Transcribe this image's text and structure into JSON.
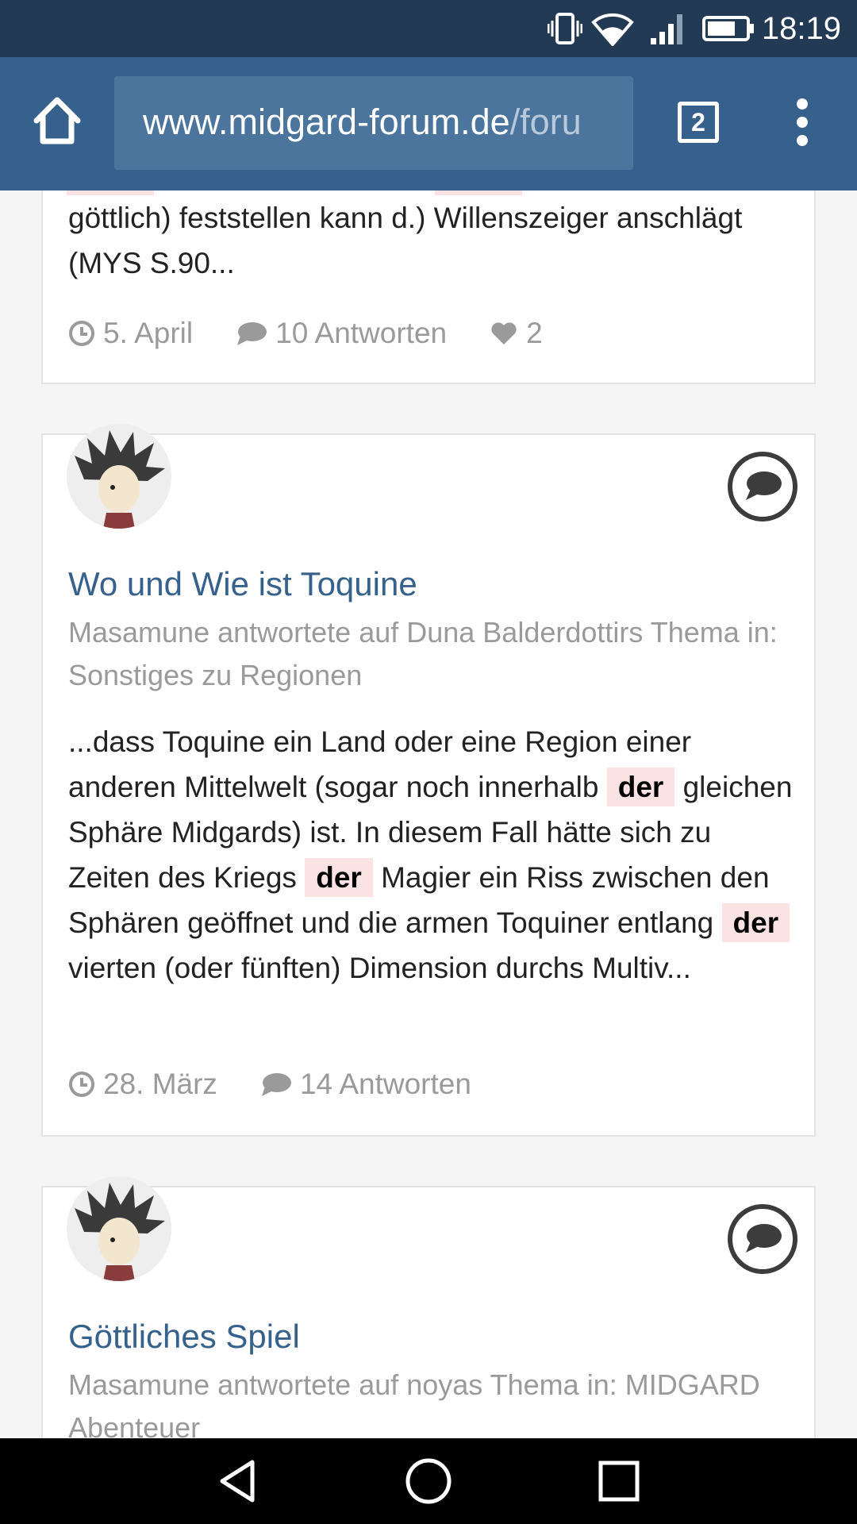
{
  "status_bar": {
    "time": "18:19",
    "icons": [
      "vibrate-icon",
      "wifi-icon",
      "signal-icon",
      "battery-icon"
    ]
  },
  "browser": {
    "url_domain": "www.midgard-forum.de",
    "url_path": "/foru",
    "tab_count": "2",
    "icons": [
      "home-icon",
      "tabs-icon",
      "overflow-menu-icon"
    ]
  },
  "results": [
    {
      "excerpt_lines": [
        "göttlich) feststellen kann d.) Willenszeiger anschlägt",
        "(MYS S.90..."
      ],
      "date": "5. April",
      "replies": "10 Antworten",
      "likes": "2"
    },
    {
      "title": "Wo und Wie ist Toquine",
      "meta": "Masamune antwortete auf Duna Balderdottirs Thema in: Sonstiges zu Regionen",
      "excerpt": {
        "p1": "...dass Toquine ein Land oder eine Region einer anderen Mittelwelt (sogar noch innerhalb",
        "hl1": "der",
        "p2": " gleichen Sphäre Midgards) ist. In diesem Fall hätte sich zu Zeiten des Kriegs",
        "hl2": "der",
        "p3": " Magier ein Riss zwischen den Sphären geöffnet und die armen Toquiner entlang",
        "hl3": "der",
        "p4": " vierten (oder fünften) Dimension durchs Multiv..."
      },
      "date": "28. März",
      "replies": "14 Antworten"
    },
    {
      "title": "Göttliches Spiel",
      "meta": "Masamune antwortete auf noyas Thema in: MIDGARD Abenteuer"
    }
  ],
  "colors": {
    "status_bar": "#223a53",
    "toolbar": "#35618c",
    "link": "#35618c",
    "highlight": "#fbe3e3",
    "muted": "#9a9a9a"
  }
}
